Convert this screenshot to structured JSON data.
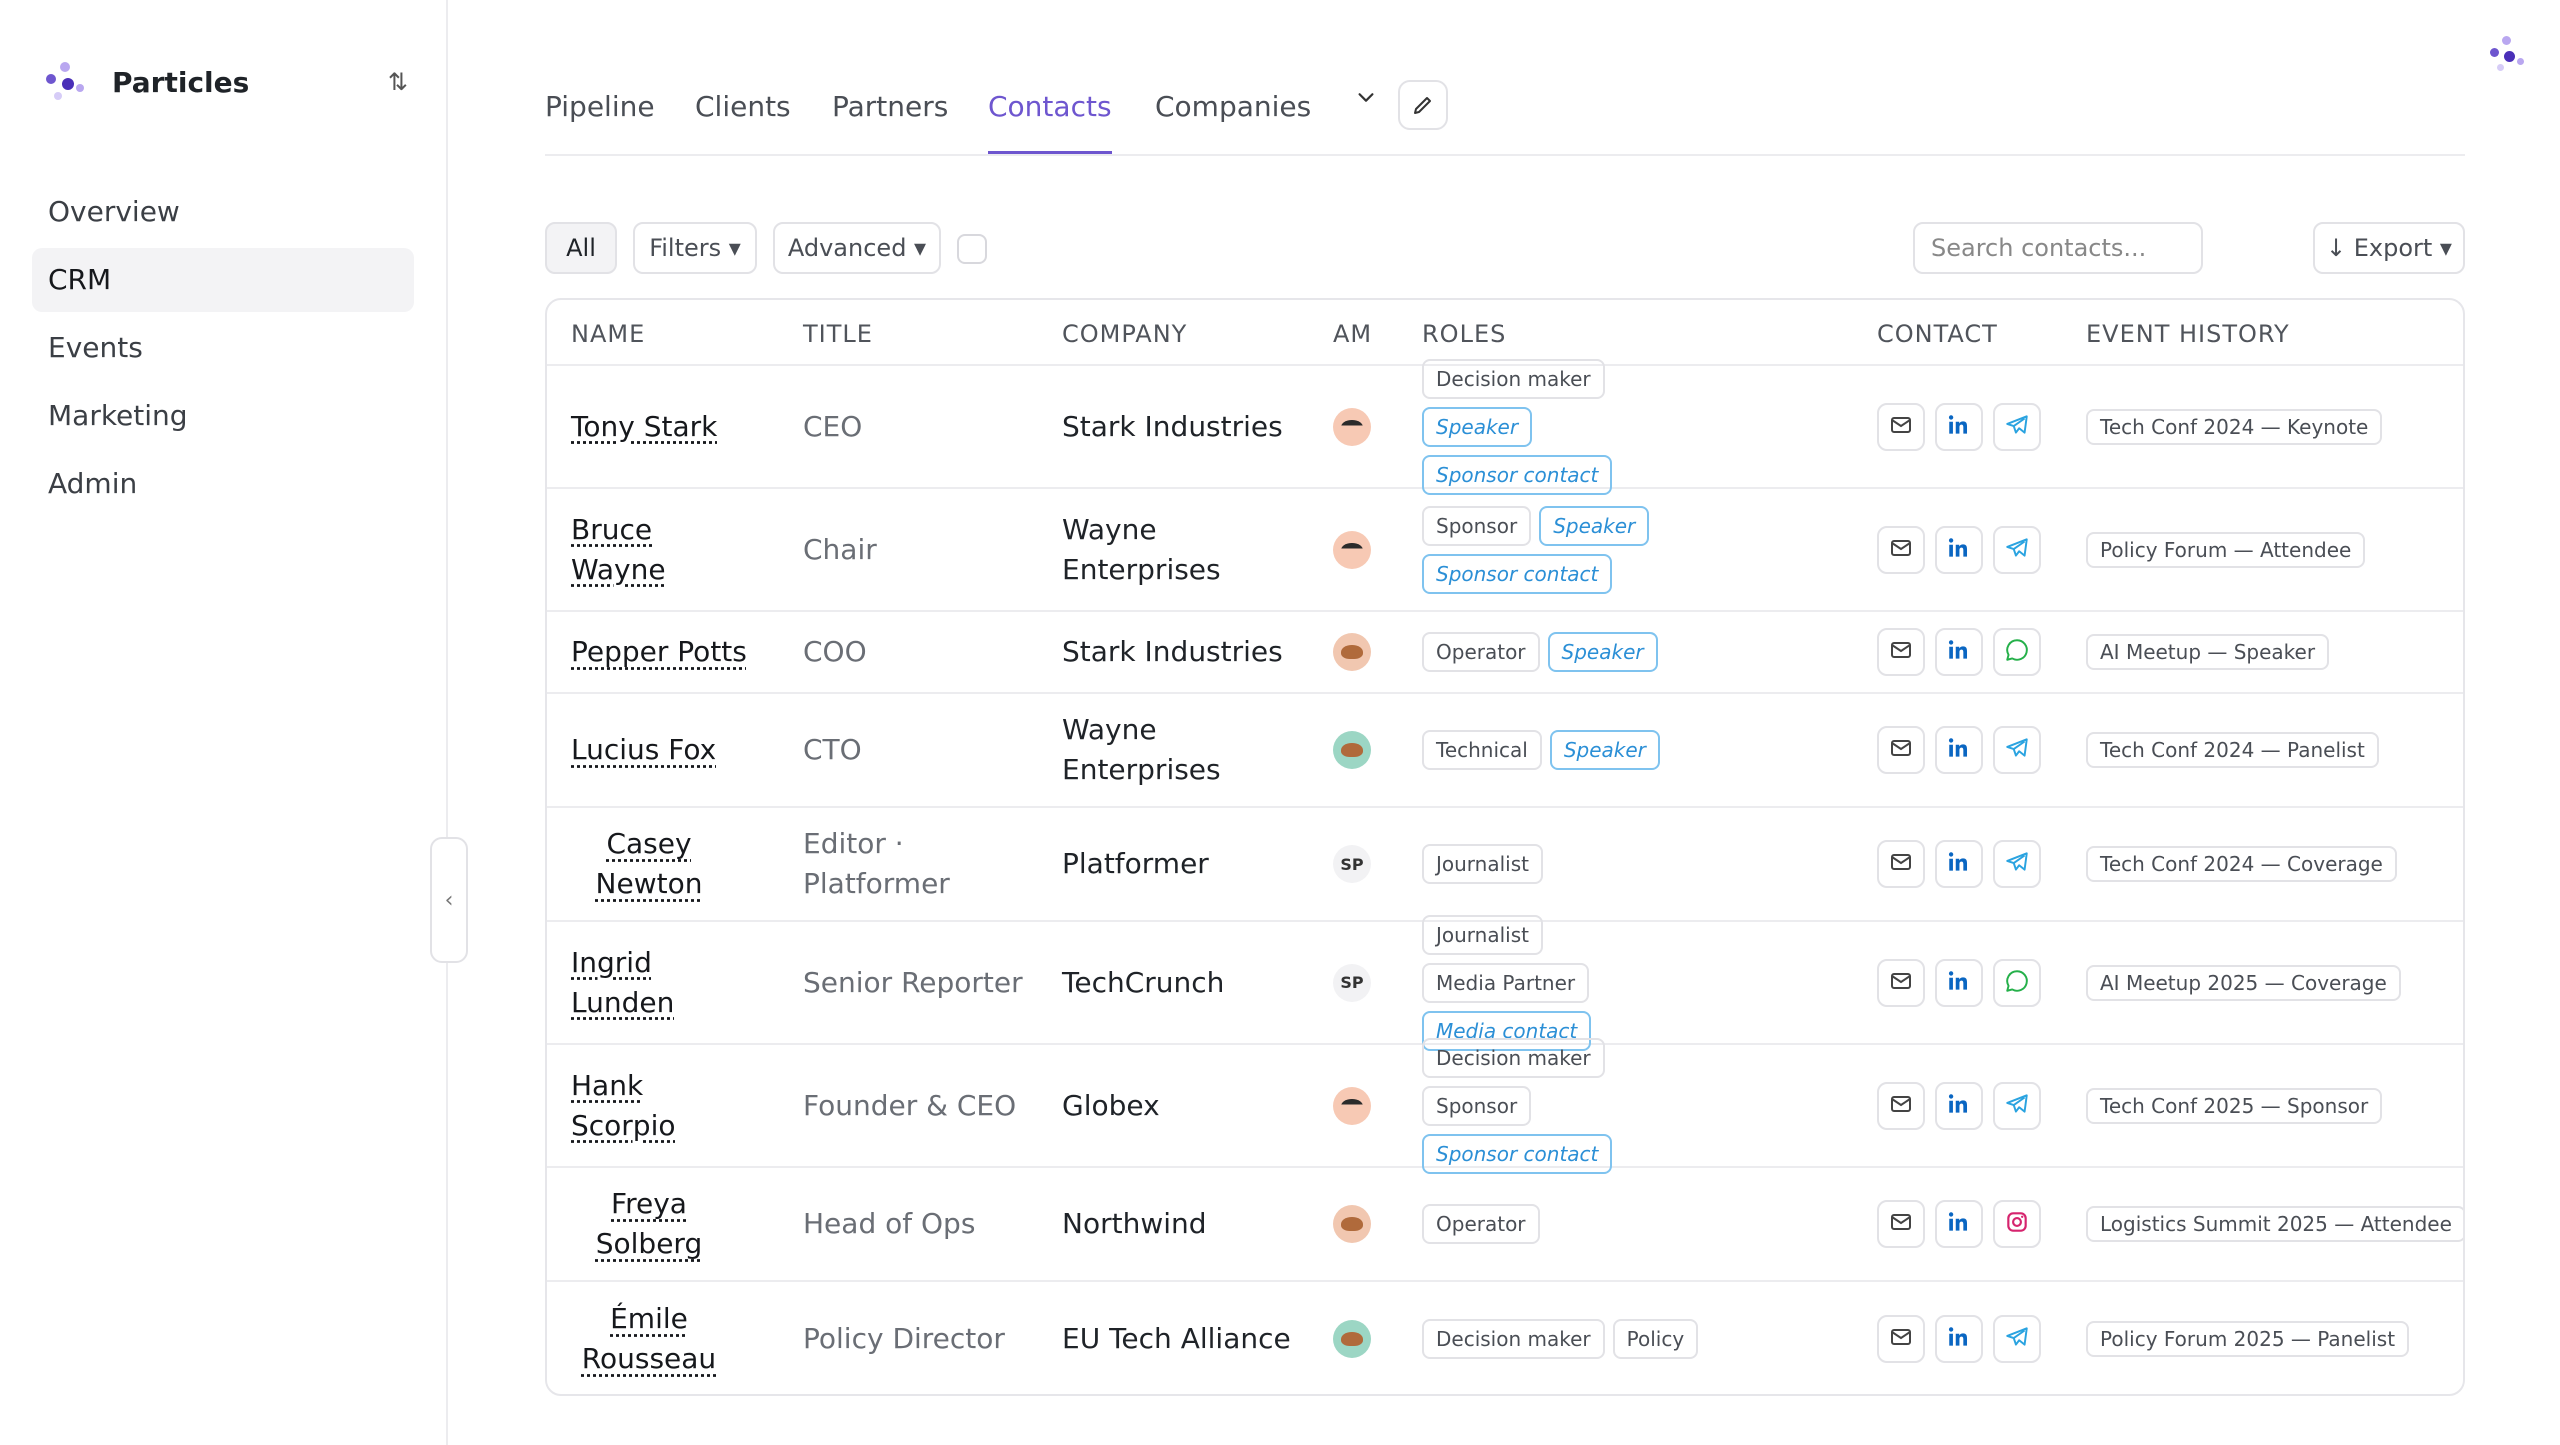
{
  "brand": {
    "name": "Particles",
    "switch_icon": "⇅"
  },
  "nav": [
    "Overview",
    "CRM",
    "Events",
    "Marketing",
    "Admin"
  ],
  "tabs": [
    "Pipeline",
    "Clients",
    "Partners",
    "Contacts",
    "Companies"
  ],
  "active_tab": "Contacts",
  "toolbar": {
    "all_label": "All",
    "filters_label": "Filters ▾",
    "advanced_label": "Advanced ▾",
    "search_placeholder": "Search contacts...",
    "export_label": "↓ Export ▾"
  },
  "columns": [
    "NAME",
    "TITLE",
    "COMPANY",
    "AM",
    "ROLES",
    "CONTACT",
    "EVENT HISTORY"
  ],
  "colors": {
    "accent": "#6e56cf",
    "role_highlight": "#2b8fd6",
    "linkedin": "#0a66c2",
    "telegram": "#2aa3e0",
    "whatsapp": "#25b04a",
    "instagram": "#d6246e"
  },
  "rows": [
    {
      "name": "Tony Stark",
      "title": "CEO",
      "company": "Stark Industries",
      "am": "face",
      "am_text": "",
      "roles": [
        {
          "label": "Decision maker",
          "hl": false
        },
        {
          "label": "Speaker",
          "hl": true
        },
        {
          "label": "Sponsor contact",
          "hl": true
        }
      ],
      "channel": "telegram",
      "event": "Tech Conf 2024 — Keynote"
    },
    {
      "name": "Bruce Wayne",
      "title": "Chair",
      "company": "Wayne Enterprises",
      "am": "face",
      "am_text": "",
      "roles": [
        {
          "label": "Sponsor",
          "hl": false
        },
        {
          "label": "Speaker",
          "hl": true
        },
        {
          "label": "Sponsor contact",
          "hl": true
        }
      ],
      "channel": "telegram",
      "event": "Policy Forum — Attendee"
    },
    {
      "name": "Pepper Potts",
      "title": "COO",
      "company": "Stark Industries",
      "am": "brown",
      "am_text": "",
      "roles": [
        {
          "label": "Operator",
          "hl": false
        },
        {
          "label": "Speaker",
          "hl": true
        }
      ],
      "channel": "whatsapp",
      "event": "AI Meetup — Speaker"
    },
    {
      "name": "Lucius Fox",
      "title": "CTO",
      "company": "Wayne Enterprises",
      "am": "green",
      "am_text": "",
      "roles": [
        {
          "label": "Technical",
          "hl": false
        },
        {
          "label": "Speaker",
          "hl": true
        }
      ],
      "channel": "telegram",
      "event": "Tech Conf 2024 — Panelist"
    },
    {
      "name": "Casey Newton",
      "title": "Editor · Platformer",
      "company": "Platformer",
      "am": "sp",
      "am_text": "SP",
      "roles": [
        {
          "label": "Journalist",
          "hl": false
        }
      ],
      "channel": "telegram",
      "event": "Tech Conf 2024 — Coverage"
    },
    {
      "name": "Ingrid Lunden",
      "title": "Senior Reporter",
      "company": "TechCrunch",
      "am": "sp",
      "am_text": "SP",
      "roles": [
        {
          "label": "Journalist",
          "hl": false
        },
        {
          "label": "Media Partner",
          "hl": false
        },
        {
          "label": "Media contact",
          "hl": true
        }
      ],
      "channel": "whatsapp",
      "event": "AI Meetup 2025 — Coverage"
    },
    {
      "name": "Hank Scorpio",
      "title": "Founder & CEO",
      "company": "Globex",
      "am": "face",
      "am_text": "",
      "roles": [
        {
          "label": "Decision maker",
          "hl": false
        },
        {
          "label": "Sponsor",
          "hl": false
        },
        {
          "label": "Sponsor contact",
          "hl": true
        }
      ],
      "channel": "telegram",
      "event": "Tech Conf 2025 — Sponsor"
    },
    {
      "name": "Freya Solberg",
      "title": "Head of Ops",
      "company": "Northwind",
      "am": "brown",
      "am_text": "",
      "roles": [
        {
          "label": "Operator",
          "hl": false
        }
      ],
      "channel": "instagram",
      "event": "Logistics Summit 2025 — Attendee"
    },
    {
      "name": "Émile Rousseau",
      "title": "Policy Director",
      "company": "EU Tech Alliance",
      "am": "green",
      "am_text": "",
      "roles": [
        {
          "label": "Decision maker",
          "hl": false
        },
        {
          "label": "Policy",
          "hl": false
        }
      ],
      "channel": "telegram",
      "event": "Policy Forum 2025 — Panelist"
    }
  ]
}
